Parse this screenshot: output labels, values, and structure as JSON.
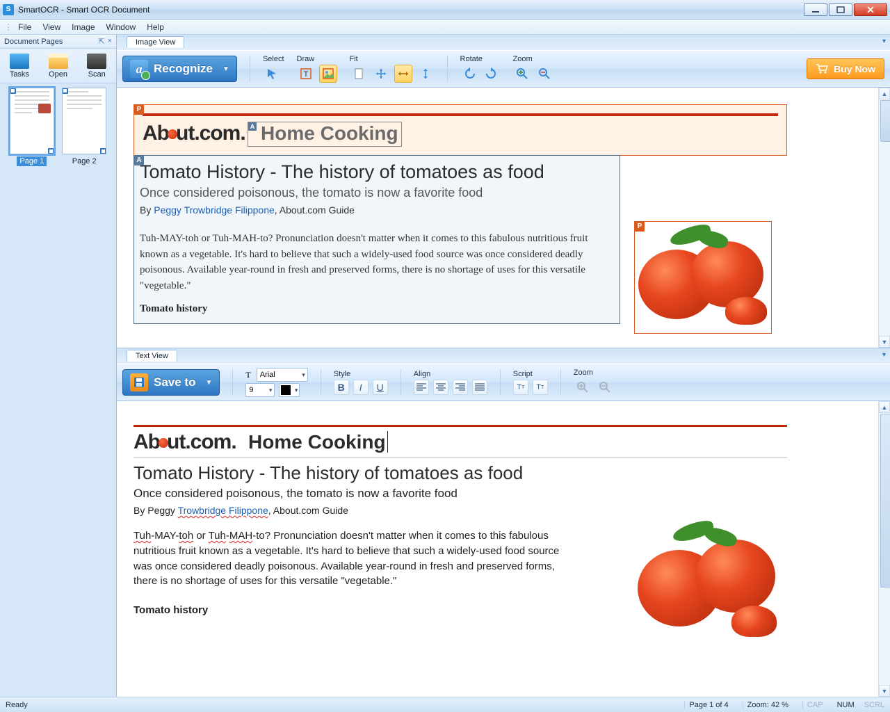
{
  "app": {
    "title": "SmartOCR - Smart OCR Document"
  },
  "menubar": [
    "File",
    "View",
    "Image",
    "Window",
    "Help"
  ],
  "sidebar": {
    "title": "Document Pages",
    "buttons": {
      "tasks": "Tasks",
      "open": "Open",
      "scan": "Scan"
    },
    "pages": [
      "Page 1",
      "Page 2"
    ]
  },
  "image_view": {
    "tab": "Image View",
    "recognize": "Recognize",
    "groups": {
      "select": "Select",
      "draw": "Draw",
      "fit": "Fit",
      "rotate": "Rotate",
      "zoom": "Zoom"
    },
    "buy": "Buy Now",
    "tags": {
      "p": "P",
      "a": "A"
    },
    "article": {
      "brand_pre": "Ab",
      "brand_post": "ut",
      "brand_dom": ".com",
      "section": "Home Cooking",
      "h1": "Tomato History - The history of tomatoes as food",
      "h2": "Once considered poisonous, the tomato is now a favorite food",
      "by_pre": "By ",
      "by_link": "Peggy Trowbridge Filippone",
      "by_post": ", About.com Guide",
      "p1": "Tuh-MAY-toh or Tuh-MAH-to? Pronunciation doesn't matter when it comes to this fabulous nutritious fruit known as a vegetable. It's hard to believe that such a widely-used food source was once considered deadly poisonous. Available year-round in fresh and preserved forms, there is no shortage of uses for this versatile \"vegetable.\"",
      "sub": "Tomato history"
    }
  },
  "text_view": {
    "tab": "Text View",
    "save": "Save to",
    "font_name": "Arial",
    "font_size": "9",
    "groups": {
      "style": "Style",
      "align": "Align",
      "script": "Script",
      "zoom": "Zoom"
    },
    "article": {
      "brand_pre": "Ab",
      "brand_post": "ut",
      "brand_dom": ".com",
      "section": "Home Cooking",
      "h1_a": "Tomato History - The history of  ",
      "h1_b": "tomatoes",
      "h1_c": "  as  food",
      "h2": "Once considered poisonous, the tomato is now a  favorite food",
      "by_pre": "By Peggy ",
      "by_link": "Trowbridge Filippone",
      "by_post": ", About.com Guide",
      "p_a": "Tuh",
      "p_b": "-MAY-",
      "p_c": "toh",
      "p_d": " or ",
      "p_e": "Tuh",
      "p_f": "-",
      "p_g": "MAH",
      "p_rest": "-to? Pronunciation doesn't matter when it comes to this fabulous nutritious fruit known as a vegetable. It's hard to believe that such a widely-used food source was once considered deadly poisonous. Available year-round in fresh and preserved forms, there is no shortage of uses for this versatile \"vegetable.\"",
      "sub": "Tomato history"
    }
  },
  "status": {
    "ready": "Ready",
    "page": "Page 1 of 4",
    "zoom": "Zoom: 42 %",
    "cap": "CAP",
    "num": "NUM",
    "scrl": "SCRL"
  }
}
